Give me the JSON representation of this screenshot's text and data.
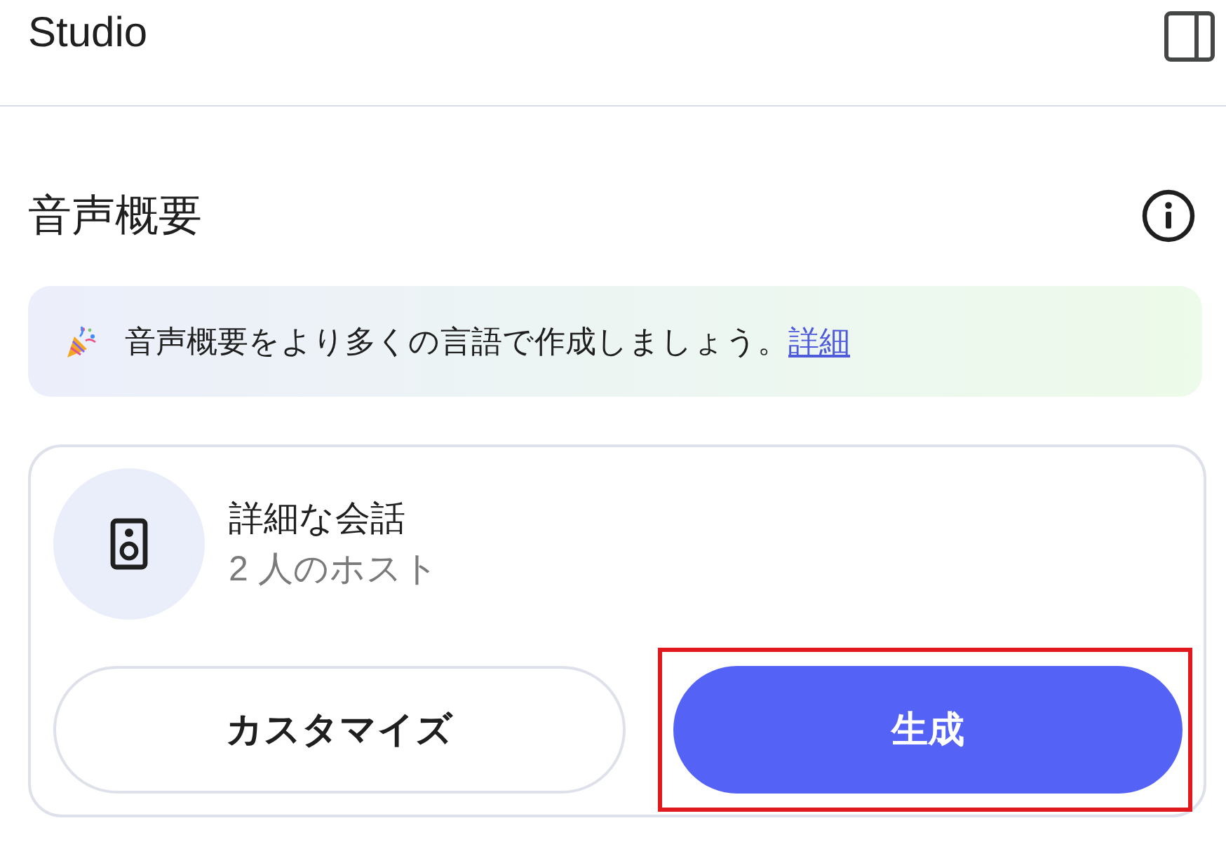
{
  "header": {
    "title": "Studio"
  },
  "section": {
    "title": "音声概要"
  },
  "banner": {
    "message": "音声概要をより多くの言語で作成しましょう。",
    "link": "詳細"
  },
  "card": {
    "title": "詳細な会話",
    "subtitle": "2 人のホスト"
  },
  "buttons": [
    {
      "kind": "outline",
      "label": "カスタマイズ",
      "highlighted": false
    },
    {
      "kind": "primary",
      "label": "生成",
      "highlighted": true
    }
  ]
}
